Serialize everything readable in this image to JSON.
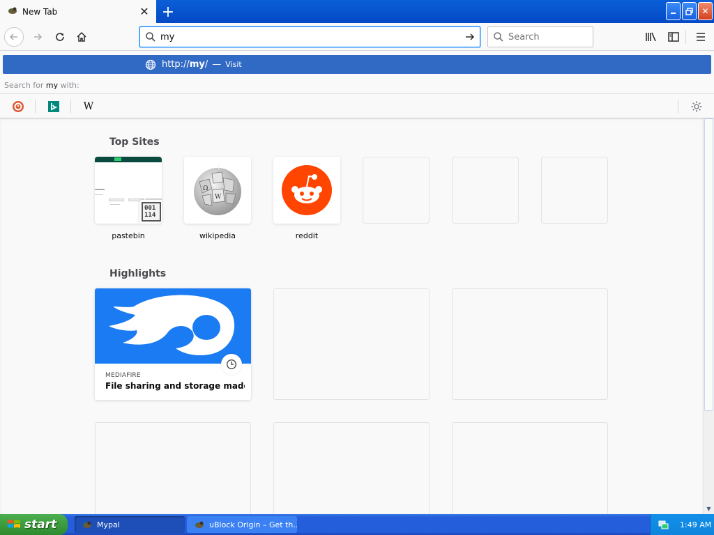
{
  "tab": {
    "title": "New Tab"
  },
  "navbar": {
    "url_value": "my",
    "search_placeholder": "Search"
  },
  "dropdown": {
    "suggestion_prefix": "http://",
    "suggestion_bold": "my",
    "suggestion_suffix": "/",
    "suggestion_sep": "—",
    "suggestion_action": "Visit",
    "search_for_prefix": "Search for ",
    "search_for_term": "my",
    "search_for_suffix": " with:",
    "engines": [
      "duckduckgo-icon",
      "bing-icon",
      "wikipedia-icon"
    ],
    "wiki_letter": "W"
  },
  "content": {
    "top_sites_title": "Top Sites",
    "top_sites": [
      {
        "label": "pastebin"
      },
      {
        "label": "wikipedia"
      },
      {
        "label": "reddit"
      }
    ],
    "highlights_title": "Highlights",
    "highlight": {
      "source": "MEDIAFIRE",
      "title": "File sharing and storage made si..."
    },
    "pastebin_code": "001\n114"
  },
  "taskbar": {
    "start_label": "start",
    "tasks": [
      {
        "label": "Mypal",
        "active": true
      },
      {
        "label": "uBlock Origin – Get th...",
        "active": false
      }
    ],
    "time": "1:49 AM"
  },
  "colors": {
    "titlebar": "#0549c5",
    "suggest_highlight": "#316ac5",
    "mediafire_blue": "#1b7bf2",
    "reddit_orange": "#ff4500"
  }
}
